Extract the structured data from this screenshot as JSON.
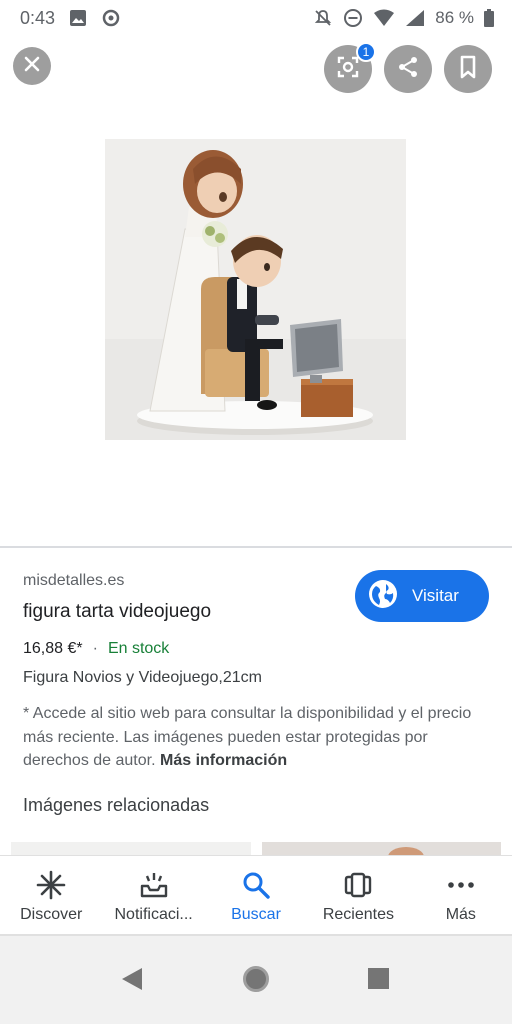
{
  "status_bar": {
    "time": "0:43",
    "battery_text": "86 %",
    "icons": [
      "image-icon",
      "cast-icon",
      "mute-icon",
      "dnd-icon",
      "wifi-icon",
      "signal-icon",
      "battery-icon"
    ]
  },
  "overlay": {
    "lens_badge": "1"
  },
  "result": {
    "site": "misdetalles.es",
    "title": "figura tarta videojuego",
    "visit_label": "Visitar",
    "price": "16,88 €*",
    "separator": "·",
    "stock": "En stock",
    "description": "Figura Novios y Videojuego,21cm",
    "disclaimer": "* Accede al sitio web para consultar la disponibilidad y el precio más reciente. Las imágenes pueden estar protegidas por derechos de autor.",
    "more_info": "Más información",
    "related_heading": "Imágenes relacionadas"
  },
  "bottom_nav": {
    "items": [
      {
        "label": "Discover",
        "icon": "asterisk-icon",
        "active": false
      },
      {
        "label": "Notificaci...",
        "icon": "inbox-icon",
        "active": false
      },
      {
        "label": "Buscar",
        "icon": "search-icon",
        "active": true
      },
      {
        "label": "Recientes",
        "icon": "recents-icon",
        "active": false
      },
      {
        "label": "Más",
        "icon": "more-icon",
        "active": false
      }
    ]
  },
  "colors": {
    "accent": "#1a73e8",
    "stock_green": "#188038",
    "overlay_button": "#9e9e9e"
  }
}
